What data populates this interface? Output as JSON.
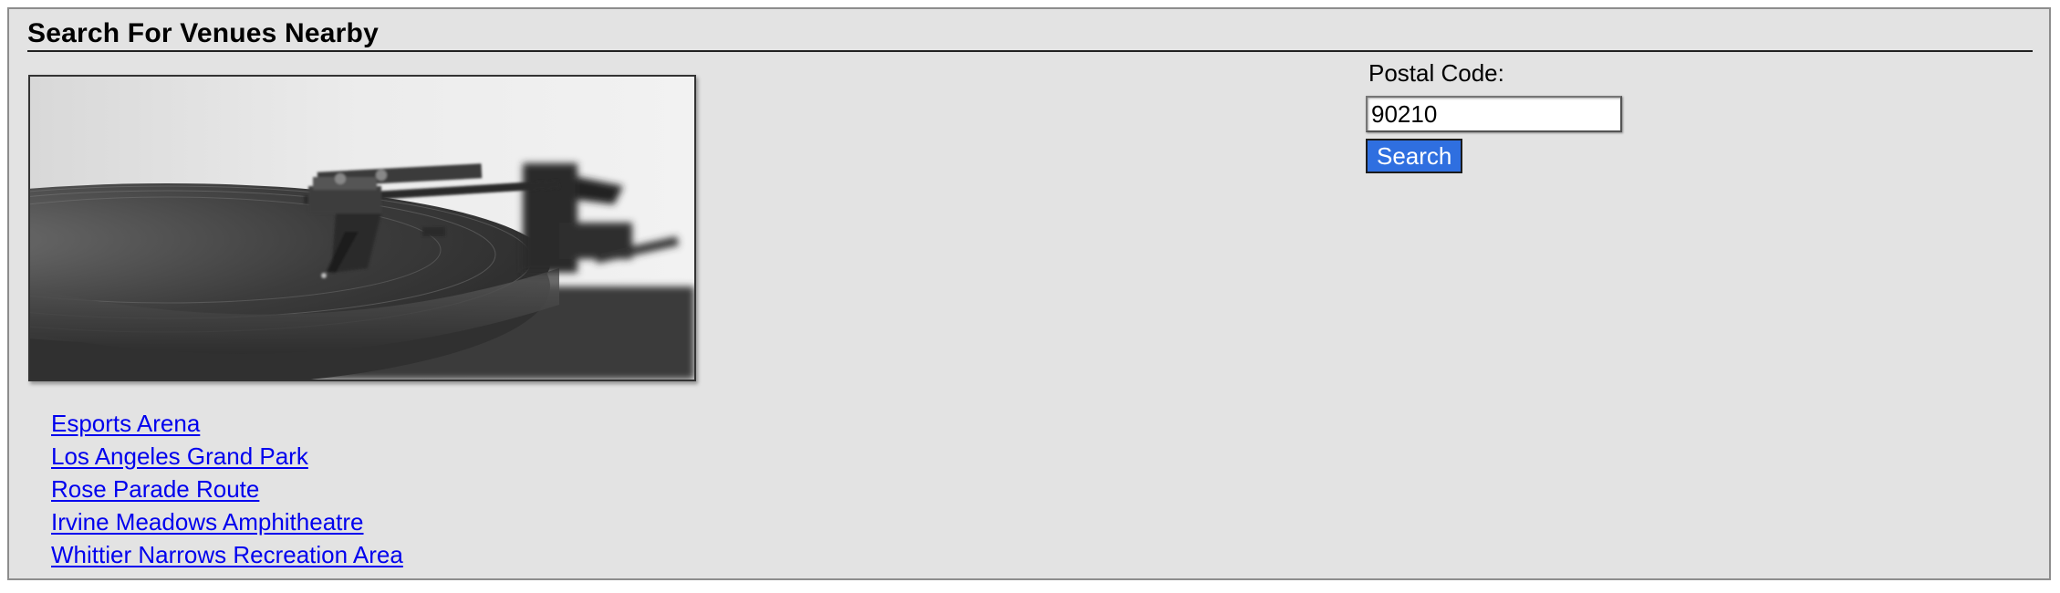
{
  "header": {
    "title": "Search For Venues Nearby"
  },
  "hero_image": {
    "subject": "turntable-photo"
  },
  "search": {
    "label": "Postal Code:",
    "value": "90210",
    "button_label": "Search",
    "button_color": "#2f6fe0"
  },
  "venues": [
    {
      "label": "Esports Arena"
    },
    {
      "label": "Los Angeles Grand Park"
    },
    {
      "label": "Rose Parade Route"
    },
    {
      "label": "Irvine Meadows Amphitheatre"
    },
    {
      "label": "Whittier Narrows Recreation Area"
    }
  ],
  "colors": {
    "panel_background": "#e3e3e3",
    "link": "#0000ee"
  }
}
